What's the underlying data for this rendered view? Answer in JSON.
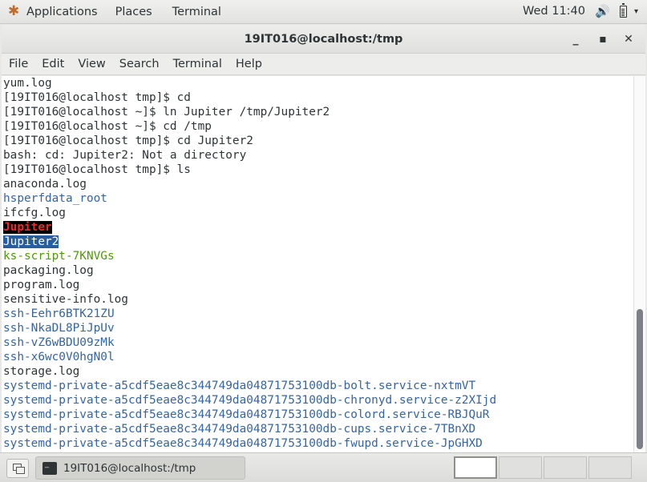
{
  "topbar": {
    "applications": "Applications",
    "places": "Places",
    "terminal": "Terminal",
    "clock": "Wed 11:40"
  },
  "window": {
    "title": "19IT016@localhost:/tmp",
    "menu": [
      "File",
      "Edit",
      "View",
      "Search",
      "Terminal",
      "Help"
    ]
  },
  "terminal_lines": [
    {
      "text": "yum.log",
      "style": "plain"
    },
    {
      "text": "[19IT016@localhost tmp]$ cd",
      "style": "plain"
    },
    {
      "text": "[19IT016@localhost ~]$ ln Jupiter /tmp/Jupiter2",
      "style": "plain"
    },
    {
      "text": "[19IT016@localhost ~]$ cd /tmp",
      "style": "plain"
    },
    {
      "text": "[19IT016@localhost tmp]$ cd Jupiter2",
      "style": "plain"
    },
    {
      "text": "bash: cd: Jupiter2: Not a directory",
      "style": "plain"
    },
    {
      "text": "[19IT016@localhost tmp]$ ls",
      "style": "plain"
    },
    {
      "text": "anaconda.log",
      "style": "plain"
    },
    {
      "text": "hsperfdata_root",
      "style": "dir"
    },
    {
      "text": "ifcfg.log",
      "style": "plain"
    },
    {
      "text": "Jupiter",
      "style": "broken"
    },
    {
      "text": "Jupiter2",
      "style": "selected"
    },
    {
      "text": "ks-script-7KNVGs",
      "style": "exec"
    },
    {
      "text": "packaging.log",
      "style": "plain"
    },
    {
      "text": "program.log",
      "style": "plain"
    },
    {
      "text": "sensitive-info.log",
      "style": "plain"
    },
    {
      "text": "ssh-Eehr6BTK21ZU",
      "style": "dir"
    },
    {
      "text": "ssh-NkaDL8PiJpUv",
      "style": "dir"
    },
    {
      "text": "ssh-vZ6wBDU09zMk",
      "style": "dir"
    },
    {
      "text": "ssh-x6wc0V0hgN0l",
      "style": "dir"
    },
    {
      "text": "storage.log",
      "style": "plain"
    },
    {
      "text": "systemd-private-a5cdf5eae8c344749da04871753100db-bolt.service-nxtmVT",
      "style": "dir"
    },
    {
      "text": "systemd-private-a5cdf5eae8c344749da04871753100db-chronyd.service-z2XIjd",
      "style": "dir"
    },
    {
      "text": "systemd-private-a5cdf5eae8c344749da04871753100db-colord.service-RBJQuR",
      "style": "dir"
    },
    {
      "text": "systemd-private-a5cdf5eae8c344749da04871753100db-cups.service-7TBnXD",
      "style": "dir"
    },
    {
      "text": "systemd-private-a5cdf5eae8c344749da04871753100db-fwupd.service-JpGHXD",
      "style": "dir"
    }
  ],
  "taskbar": {
    "task_label": "19IT016@localhost:/tmp"
  }
}
